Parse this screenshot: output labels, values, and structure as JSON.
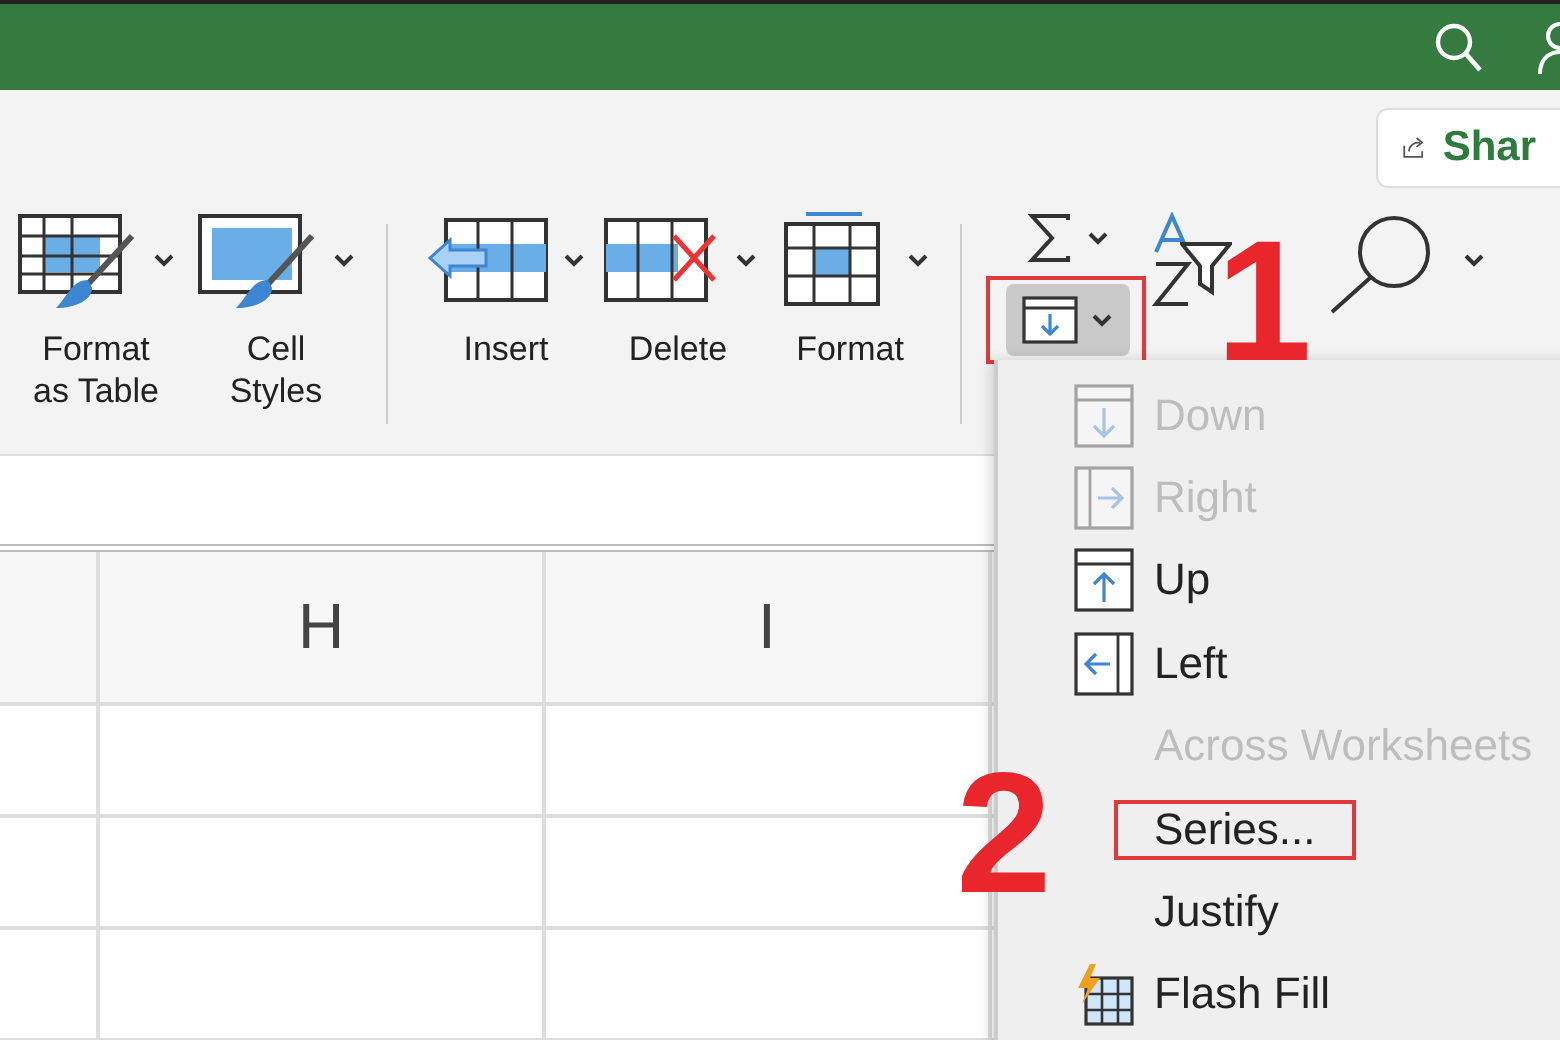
{
  "share_button": {
    "label": "Shar"
  },
  "ribbon": {
    "groups": [
      {
        "buttons": [
          {
            "lines": [
              "Format",
              "as Table"
            ]
          },
          {
            "lines": [
              "Cell",
              "Styles"
            ]
          }
        ]
      },
      {
        "buttons": [
          {
            "lines": [
              "Insert"
            ]
          },
          {
            "lines": [
              "Delete"
            ]
          },
          {
            "lines": [
              "Format"
            ]
          }
        ]
      }
    ],
    "editing": {
      "fill_button": {
        "boxed": true
      }
    }
  },
  "columns": [
    {
      "label": "H"
    },
    {
      "label": "I"
    }
  ],
  "fill_menu": {
    "items": [
      {
        "label": "Down",
        "disabled": true,
        "boxed": false
      },
      {
        "label": "Right",
        "disabled": true,
        "boxed": false
      },
      {
        "label": "Up",
        "disabled": false,
        "boxed": false
      },
      {
        "label": "Left",
        "disabled": false,
        "boxed": false
      },
      {
        "label": "Across Worksheets",
        "disabled": true,
        "boxed": false
      },
      {
        "label": "Series...",
        "disabled": false,
        "boxed": true
      },
      {
        "label": "Justify",
        "disabled": false,
        "boxed": false
      },
      {
        "label": "Flash Fill",
        "disabled": false,
        "boxed": false
      }
    ]
  },
  "annotations": [
    {
      "label": "1"
    },
    {
      "label": "2"
    }
  ]
}
